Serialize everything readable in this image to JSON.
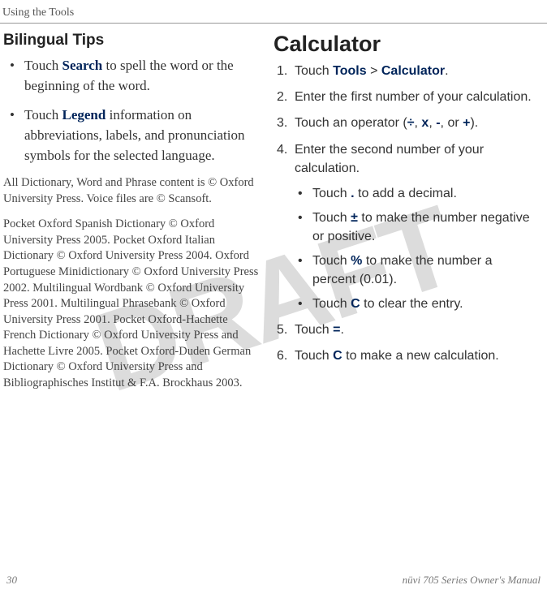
{
  "watermark": "DRAFT",
  "header": "Using the Tools",
  "left": {
    "title": "Bilingual Tips",
    "bullets": [
      {
        "pre": "Touch ",
        "link": "Search",
        "post": " to spell the word or the beginning of the word."
      },
      {
        "pre": "Touch ",
        "link": "Legend",
        "post": " information on abbreviations, labels, and pronunciation symbols for the selected language."
      }
    ],
    "note": "All Dictionary, Word and Phrase content is © Oxford University Press. Voice files are © Scansoft.",
    "copyright": "Pocket Oxford Spanish Dictionary © Oxford University Press 2005. Pocket Oxford Italian Dictionary © Oxford University Press 2004. Oxford Portuguese Minidictionary © Oxford University Press 2002. Multilingual Wordbank © Oxford University Press 2001. Multilingual Phrasebank © Oxford University Press 2001. Pocket Oxford-Hachette French Dictionary © Oxford University Press and Hachette Livre 2005. Pocket Oxford-Duden German Dictionary © Oxford University Press and Bibliographisches Institut & F.A. Brockhaus 2003."
  },
  "right": {
    "title": "Calculator",
    "step1": {
      "pre": "Touch ",
      "a": "Tools",
      "sep": " > ",
      "b": "Calculator",
      "post": "."
    },
    "step2": "Enter the first number of your calculation.",
    "step3": {
      "pre": "Touch an operator (",
      "a": "÷",
      "s1": ", ",
      "b": "x",
      "s2": ", ",
      "c": "-",
      "s3": ", or ",
      "d": "+",
      "post": ")."
    },
    "step4": "Enter the second number of your calculation.",
    "sub1": {
      "pre": "Touch ",
      "k": ".",
      "post": " to add a decimal."
    },
    "sub2": {
      "pre": "Touch ",
      "k": "±",
      "post": " to make the number negative or positive."
    },
    "sub3": {
      "pre": "Touch ",
      "k": "%",
      "post": " to make the number a percent (0.01)."
    },
    "sub4": {
      "pre": "Touch ",
      "k": "C",
      "post": " to clear the entry."
    },
    "step5": {
      "pre": "Touch ",
      "k": "=",
      "post": "."
    },
    "step6": {
      "pre": "Touch ",
      "k": "C",
      "post": " to make a new calculation."
    }
  },
  "footer": {
    "page": "30",
    "manual": "nüvi 705 Series Owner's Manual"
  }
}
